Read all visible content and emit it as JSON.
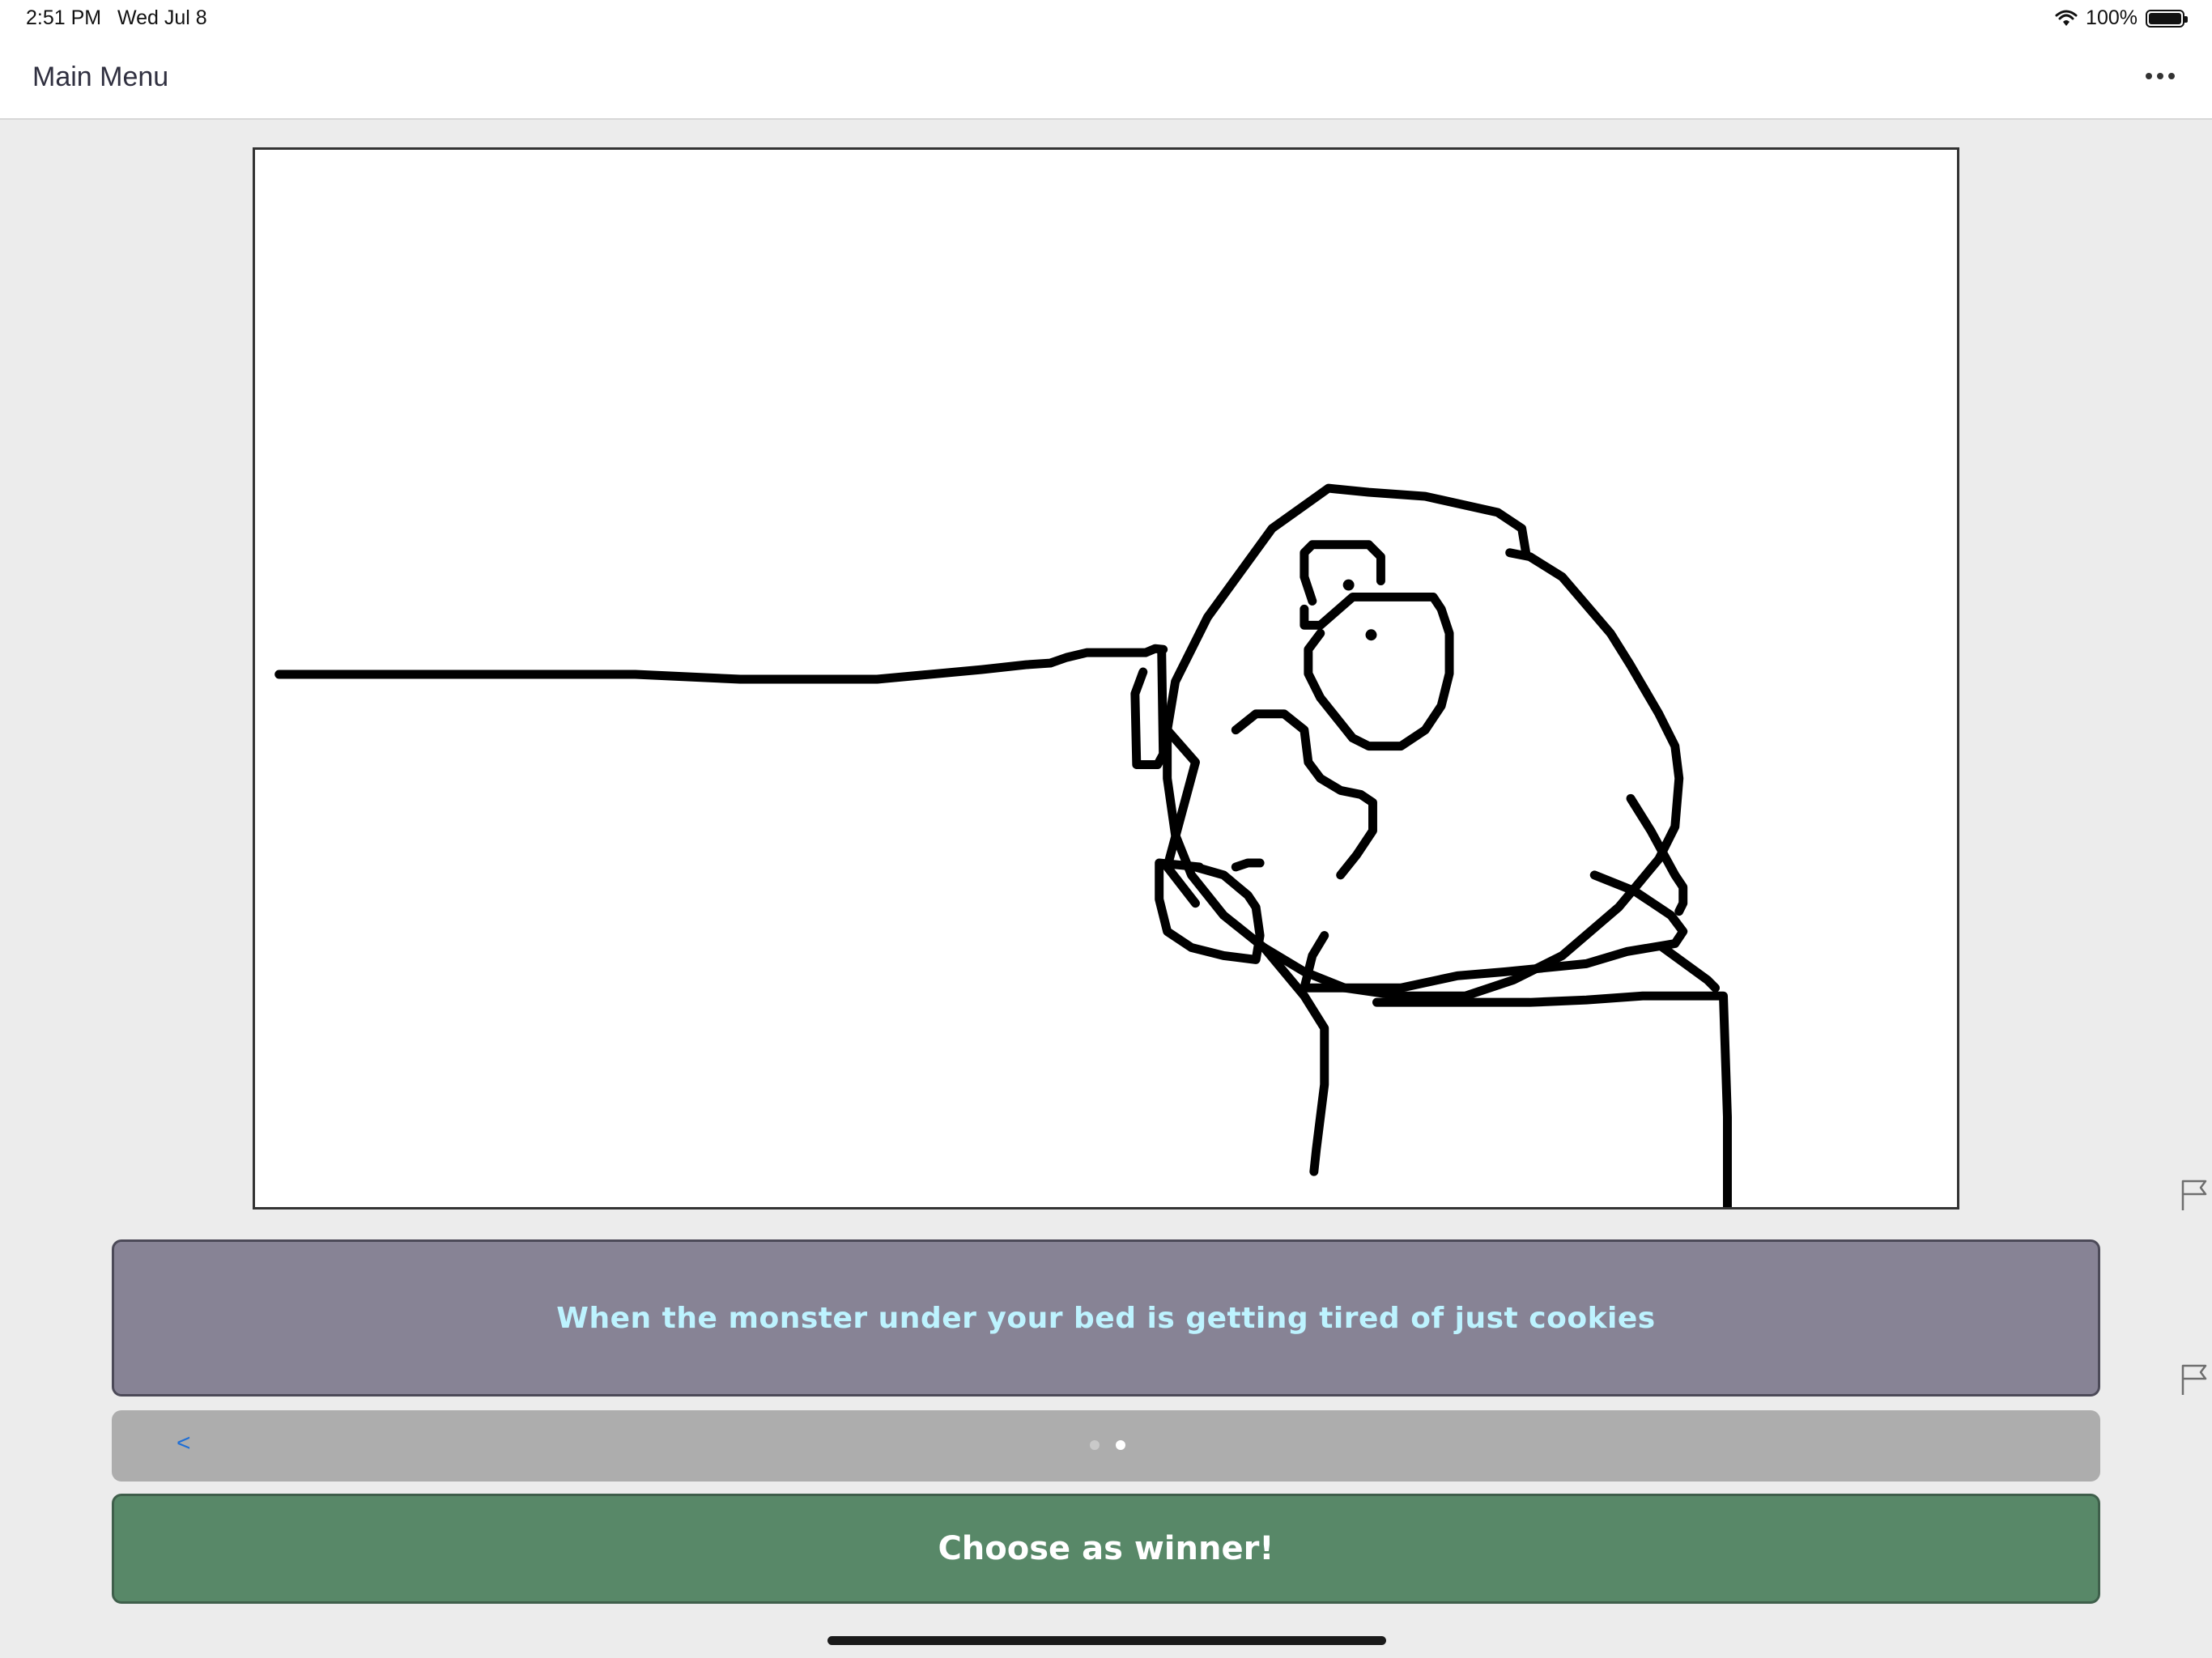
{
  "status_bar": {
    "time": "2:51 PM",
    "date": "Wed Jul 8",
    "battery": "100%",
    "wifi_icon": "wifi-icon",
    "battery_icon": "battery-icon"
  },
  "nav": {
    "title": "Main Menu",
    "more_icon": "ellipsis-icon"
  },
  "drawing": {
    "description_icon": "drawing-canvas"
  },
  "caption": {
    "text": "When the monster under your bed is getting tired of just cookies"
  },
  "pager": {
    "prev_label": "<",
    "page_count": 2,
    "current_page": 2
  },
  "actions": {
    "winner_label": "Choose as winner!"
  },
  "side_icons": [
    "flag-icon",
    "flag-icon"
  ],
  "colors": {
    "caption_bg": "#878395",
    "caption_text": "#bdf3ff",
    "winner_bg": "#588868",
    "pager_bg": "#adadad",
    "link_blue": "#1f6fd6"
  }
}
